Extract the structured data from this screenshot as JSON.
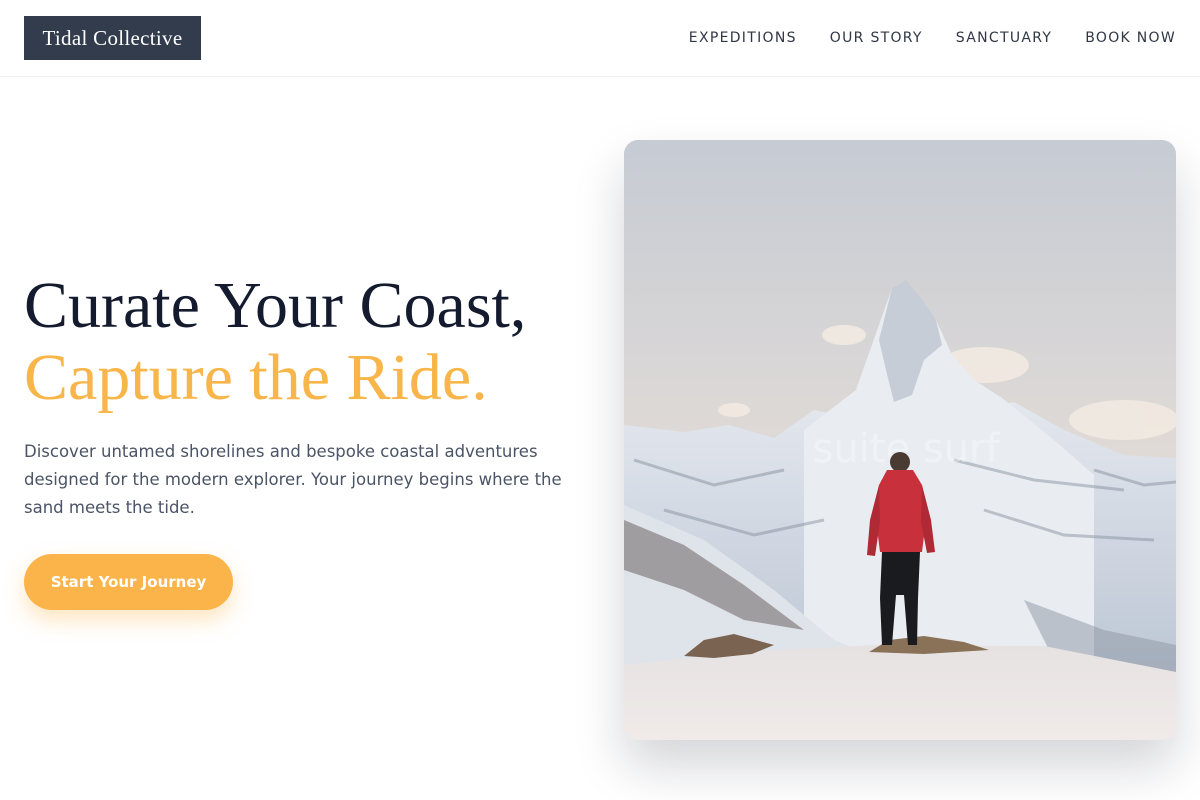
{
  "brand": {
    "name": "Tidal Collective"
  },
  "nav": {
    "items": [
      "EXPEDITIONS",
      "OUR STORY",
      "SANCTUARY",
      "BOOK NOW"
    ]
  },
  "hero": {
    "title_line1": "Curate Your Coast,",
    "title_line2": "Capture the Ride.",
    "description": "Discover untamed shorelines and bespoke coastal adventures designed for the modern explorer. Your journey begins where the sand meets the tide.",
    "cta_label": "Start Your Journey",
    "image_watermark": "suite surf"
  },
  "colors": {
    "accent": "#f8b54a",
    "logo_bg": "#323c4d",
    "title": "#141b2e",
    "body_text": "#4a5466"
  }
}
